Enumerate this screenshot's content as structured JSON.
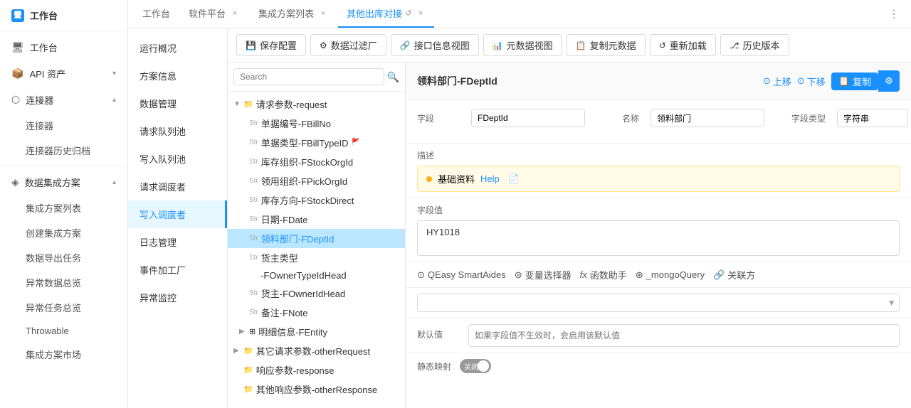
{
  "sidebar": {
    "logo": "工作台",
    "items": [
      {
        "id": "workbench",
        "label": "工作台",
        "icon": "🖥",
        "hasArrow": false
      },
      {
        "id": "api-assets",
        "label": "API 资产",
        "icon": "📦",
        "hasArrow": true
      },
      {
        "id": "connector",
        "label": "连接器",
        "icon": "🔗",
        "hasArrow": true
      },
      {
        "id": "connector-sub1",
        "label": "连接器",
        "sub": true
      },
      {
        "id": "connector-sub2",
        "label": "连接器历史归档",
        "sub": true
      },
      {
        "id": "data-integration",
        "label": "数据集成方案",
        "icon": "◈",
        "hasArrow": true
      },
      {
        "id": "integration-list",
        "label": "集成方案列表",
        "sub": true
      },
      {
        "id": "create-integration",
        "label": "创建集成方案",
        "sub": true
      },
      {
        "id": "export-task",
        "label": "数据导出任务",
        "sub": true
      },
      {
        "id": "anomaly-overview",
        "label": "异常数据总览",
        "sub": true
      },
      {
        "id": "anomaly-task",
        "label": "异常任务总览",
        "sub": true
      },
      {
        "id": "throwable",
        "label": "Throwable",
        "sub": true
      },
      {
        "id": "market",
        "label": "集成方案市场",
        "sub": true
      }
    ]
  },
  "tabs": [
    {
      "id": "workbench-tab",
      "label": "工作台",
      "closable": false,
      "active": false
    },
    {
      "id": "software-tab",
      "label": "软件平台",
      "closable": true,
      "active": false
    },
    {
      "id": "integration-list-tab",
      "label": "集成方案列表",
      "closable": true,
      "active": false
    },
    {
      "id": "other-db-tab",
      "label": "其他出库对接",
      "closable": true,
      "active": true,
      "reload": true
    }
  ],
  "nav_menu": {
    "items": [
      {
        "id": "run-overview",
        "label": "运行概况",
        "active": false
      },
      {
        "id": "scheme-info",
        "label": "方案信息",
        "active": false
      },
      {
        "id": "data-mgmt",
        "label": "数据管理",
        "active": false
      },
      {
        "id": "request-queue",
        "label": "请求队列池",
        "active": false
      },
      {
        "id": "write-queue",
        "label": "写入队列池",
        "active": false
      },
      {
        "id": "request-scheduler",
        "label": "请求调度者",
        "active": false
      },
      {
        "id": "write-scheduler",
        "label": "写入调度者",
        "active": true
      },
      {
        "id": "log-mgmt",
        "label": "日志管理",
        "active": false
      },
      {
        "id": "event-factory",
        "label": "事件加工厂",
        "active": false
      },
      {
        "id": "anomaly-monitor",
        "label": "异常监控",
        "active": false
      }
    ]
  },
  "toolbar": {
    "buttons": [
      {
        "id": "save-config",
        "icon": "💾",
        "label": "保存配置"
      },
      {
        "id": "data-filter",
        "icon": "⚙",
        "label": "数据过滤厂"
      },
      {
        "id": "interface-view",
        "icon": "🔗",
        "label": "接口信息视图"
      },
      {
        "id": "meta-view",
        "icon": "📊",
        "label": "元数据视图"
      },
      {
        "id": "copy-meta",
        "icon": "📋",
        "label": "复制元数据"
      },
      {
        "id": "reload",
        "icon": "↺",
        "label": "重新加载"
      },
      {
        "id": "history",
        "icon": "⎇",
        "label": "历史版本"
      }
    ]
  },
  "search": {
    "placeholder": "Search"
  },
  "tree": {
    "nodes": [
      {
        "id": "request-params",
        "indent": 0,
        "expand": "▼",
        "icon": "📁",
        "type": "",
        "label": "请求参数-request",
        "selected": false
      },
      {
        "id": "fbillno",
        "indent": 1,
        "expand": "",
        "icon": "",
        "type": "Str",
        "label": "单据编号-FBillNo",
        "selected": false
      },
      {
        "id": "fbilltypeid",
        "indent": 1,
        "expand": "",
        "icon": "",
        "type": "Str",
        "label": "单据类型-FBillTypeID",
        "selected": false,
        "flag": "🚩"
      },
      {
        "id": "fstockorgid",
        "indent": 1,
        "expand": "",
        "icon": "",
        "type": "Str",
        "label": "库存组织-FStockOrgId",
        "selected": false
      },
      {
        "id": "fpickorgid",
        "indent": 1,
        "expand": "",
        "icon": "",
        "type": "Str",
        "label": "领用组织-FPickOrgId",
        "selected": false
      },
      {
        "id": "fstockdirect",
        "indent": 1,
        "expand": "",
        "icon": "",
        "type": "Str",
        "label": "库存方向-FStockDirect",
        "selected": false
      },
      {
        "id": "fdate",
        "indent": 1,
        "expand": "",
        "icon": "",
        "type": "Str",
        "label": "日期-FDate",
        "selected": false
      },
      {
        "id": "fdeptid",
        "indent": 1,
        "expand": "",
        "icon": "",
        "type": "Str",
        "label": "领料部门-FDeptId",
        "selected": true
      },
      {
        "id": "fownertype",
        "indent": 1,
        "expand": "",
        "icon": "",
        "type": "Str",
        "label": "货主类型",
        "selected": false
      },
      {
        "id": "fownertype2",
        "indent": 2,
        "expand": "",
        "icon": "",
        "type": "",
        "label": "-FOwnerTypeIdHead",
        "selected": false
      },
      {
        "id": "fownerid",
        "indent": 1,
        "expand": "",
        "icon": "",
        "type": "Str",
        "label": "货主-FOwnerIdHead",
        "selected": false
      },
      {
        "id": "fnote",
        "indent": 1,
        "expand": "",
        "icon": "",
        "type": "Str",
        "label": "备注-FNote",
        "selected": false
      },
      {
        "id": "fentity",
        "indent": 1,
        "expand": "▶",
        "icon": "⊞",
        "type": "",
        "label": "明细信息-FEntity",
        "selected": false
      },
      {
        "id": "other-request",
        "indent": 0,
        "expand": "▶",
        "icon": "📁",
        "type": "",
        "label": "其它请求参数-otherRequest",
        "selected": false
      },
      {
        "id": "response",
        "indent": 0,
        "expand": "",
        "icon": "📁",
        "type": "",
        "label": "响应参数-response",
        "selected": false
      },
      {
        "id": "other-response",
        "indent": 0,
        "expand": "",
        "icon": "📁",
        "type": "",
        "label": "其他响应参数-otherResponse",
        "selected": false
      }
    ]
  },
  "detail": {
    "title": "领料部门-FDeptId",
    "actions": {
      "up": "上移",
      "down": "下移",
      "copy": "复制"
    },
    "field_label": "字段",
    "field_value": "FDeptId",
    "name_label": "名称",
    "name_value": "领料部门",
    "type_label": "字段类型",
    "type_value": "字符串",
    "desc_label": "描述",
    "desc_content": "基础资料",
    "desc_help": "Help",
    "value_label": "字段值",
    "field_val_content": "HY1018",
    "tools": [
      {
        "id": "qeasy",
        "icon": "⊙",
        "label": "QEasy SmartAides"
      },
      {
        "id": "var-selector",
        "icon": "⊜",
        "label": "变量选择器"
      },
      {
        "id": "func-helper",
        "icon": "fx",
        "label": "函数助手"
      },
      {
        "id": "mongo-query",
        "icon": "⊛",
        "label": "_mongoQuery"
      },
      {
        "id": "related",
        "icon": "🔗",
        "label": "关联方"
      }
    ],
    "default_label": "默认值",
    "default_placeholder": "如果字段值不生效时，会启用该默认值",
    "static_label": "静态映射",
    "toggle_label": "关闭",
    "toggle_state": "off"
  }
}
